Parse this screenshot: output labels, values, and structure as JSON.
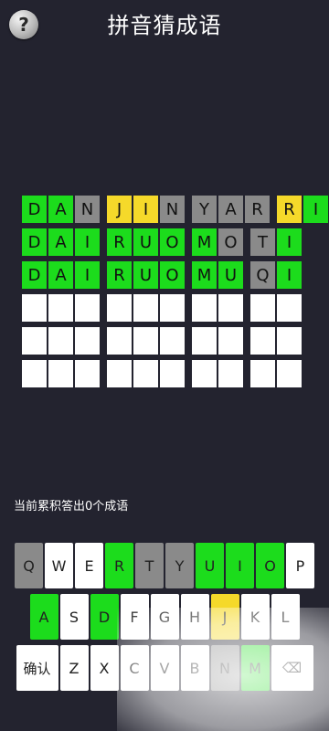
{
  "header": {
    "title": "拼音猜成语",
    "help_label": "?",
    "help_icon": "question-mark-icon"
  },
  "board": {
    "rows": [
      [
        [
          {
            "t": "D",
            "s": "green"
          },
          {
            "t": "A",
            "s": "green"
          },
          {
            "t": "N",
            "s": "gray"
          }
        ],
        [
          {
            "t": "J",
            "s": "yellow"
          },
          {
            "t": "I",
            "s": "yellow"
          },
          {
            "t": "N",
            "s": "gray"
          }
        ],
        [
          {
            "t": "Y",
            "s": "gray"
          },
          {
            "t": "A",
            "s": "gray"
          },
          {
            "t": "R",
            "s": "gray"
          }
        ],
        [
          {
            "t": "R",
            "s": "yellow"
          },
          {
            "t": "I",
            "s": "green"
          }
        ]
      ],
      [
        [
          {
            "t": "D",
            "s": "green"
          },
          {
            "t": "A",
            "s": "green"
          },
          {
            "t": "I",
            "s": "green"
          }
        ],
        [
          {
            "t": "R",
            "s": "green"
          },
          {
            "t": "U",
            "s": "green"
          },
          {
            "t": "O",
            "s": "green"
          }
        ],
        [
          {
            "t": "M",
            "s": "green"
          },
          {
            "t": "O",
            "s": "gray"
          }
        ],
        [
          {
            "t": "T",
            "s": "gray"
          },
          {
            "t": "I",
            "s": "green"
          }
        ]
      ],
      [
        [
          {
            "t": "D",
            "s": "green"
          },
          {
            "t": "A",
            "s": "green"
          },
          {
            "t": "I",
            "s": "green"
          }
        ],
        [
          {
            "t": "R",
            "s": "green"
          },
          {
            "t": "U",
            "s": "green"
          },
          {
            "t": "O",
            "s": "green"
          }
        ],
        [
          {
            "t": "M",
            "s": "green"
          },
          {
            "t": "U",
            "s": "green"
          }
        ],
        [
          {
            "t": "Q",
            "s": "gray"
          },
          {
            "t": "I",
            "s": "green"
          }
        ]
      ],
      [
        [
          {
            "t": "",
            "s": "empty"
          },
          {
            "t": "",
            "s": "empty"
          },
          {
            "t": "",
            "s": "empty"
          }
        ],
        [
          {
            "t": "",
            "s": "empty"
          },
          {
            "t": "",
            "s": "empty"
          },
          {
            "t": "",
            "s": "empty"
          }
        ],
        [
          {
            "t": "",
            "s": "empty"
          },
          {
            "t": "",
            "s": "empty"
          }
        ],
        [
          {
            "t": "",
            "s": "empty"
          },
          {
            "t": "",
            "s": "empty"
          }
        ]
      ],
      [
        [
          {
            "t": "",
            "s": "empty"
          },
          {
            "t": "",
            "s": "empty"
          },
          {
            "t": "",
            "s": "empty"
          }
        ],
        [
          {
            "t": "",
            "s": "empty"
          },
          {
            "t": "",
            "s": "empty"
          },
          {
            "t": "",
            "s": "empty"
          }
        ],
        [
          {
            "t": "",
            "s": "empty"
          },
          {
            "t": "",
            "s": "empty"
          }
        ],
        [
          {
            "t": "",
            "s": "empty"
          },
          {
            "t": "",
            "s": "empty"
          }
        ]
      ],
      [
        [
          {
            "t": "",
            "s": "empty"
          },
          {
            "t": "",
            "s": "empty"
          },
          {
            "t": "",
            "s": "empty"
          }
        ],
        [
          {
            "t": "",
            "s": "empty"
          },
          {
            "t": "",
            "s": "empty"
          },
          {
            "t": "",
            "s": "empty"
          }
        ],
        [
          {
            "t": "",
            "s": "empty"
          },
          {
            "t": "",
            "s": "empty"
          }
        ],
        [
          {
            "t": "",
            "s": "empty"
          },
          {
            "t": "",
            "s": "empty"
          }
        ]
      ]
    ]
  },
  "status": {
    "counter_text": "当前累积答出0个成语"
  },
  "keyboard": {
    "rows": [
      [
        {
          "k": "Q",
          "s": "gray"
        },
        {
          "k": "W",
          "s": "default"
        },
        {
          "k": "E",
          "s": "default"
        },
        {
          "k": "R",
          "s": "green"
        },
        {
          "k": "T",
          "s": "gray"
        },
        {
          "k": "Y",
          "s": "gray"
        },
        {
          "k": "U",
          "s": "green"
        },
        {
          "k": "I",
          "s": "green"
        },
        {
          "k": "O",
          "s": "green"
        },
        {
          "k": "P",
          "s": "default"
        }
      ],
      [
        {
          "k": "A",
          "s": "green"
        },
        {
          "k": "S",
          "s": "default"
        },
        {
          "k": "D",
          "s": "green"
        },
        {
          "k": "F",
          "s": "default"
        },
        {
          "k": "G",
          "s": "default"
        },
        {
          "k": "H",
          "s": "default"
        },
        {
          "k": "J",
          "s": "yellow"
        },
        {
          "k": "K",
          "s": "default"
        },
        {
          "k": "L",
          "s": "default"
        }
      ],
      [
        {
          "k": "确认",
          "s": "default",
          "wide": true
        },
        {
          "k": "Z",
          "s": "default"
        },
        {
          "k": "X",
          "s": "default"
        },
        {
          "k": "C",
          "s": "default"
        },
        {
          "k": "V",
          "s": "default"
        },
        {
          "k": "B",
          "s": "default"
        },
        {
          "k": "N",
          "s": "gray"
        },
        {
          "k": "M",
          "s": "green"
        },
        {
          "k": "⌫",
          "s": "default",
          "wide": true
        }
      ]
    ]
  },
  "colors": {
    "background": "#23232f",
    "correct": "#1cdc1c",
    "present": "#f5d92a",
    "absent": "#8a8a8a",
    "empty": "#ffffff"
  }
}
